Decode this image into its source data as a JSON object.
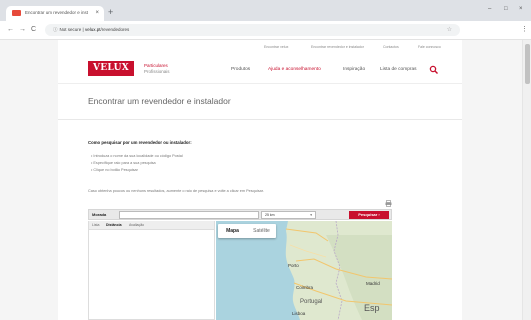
{
  "browser": {
    "tab_title": "Encontrar um revendedor e inst",
    "tab_close": "×",
    "new_tab": "+",
    "window_controls": {
      "minimize": "–",
      "maximize": "□",
      "close": "×"
    },
    "nav": {
      "back": "←",
      "forward": "→",
      "reload": "C"
    },
    "omnibox": {
      "lock": "ⓘ",
      "security": "Not secure",
      "divider": " | ",
      "host": "velux.pt",
      "path": "/revendedores"
    },
    "star": "☆",
    "menu": "⋮",
    "favicon_color": "#e64a3b"
  },
  "site": {
    "brand_color": "#c8102e",
    "logo": "VELUX",
    "utility_links": [
      "Encontrar velux",
      "Encontrar revendedor e instalador",
      "Contactos",
      "Fale connosco"
    ],
    "segments": {
      "active": "Particulares",
      "other": "Profissionais"
    },
    "nav_links": [
      "Produtos",
      "Ajuda e aconselhamento",
      "Inspiração",
      "Lista de compras"
    ],
    "page_title": "Encontrar um revendedor e instalador",
    "howto_heading": "Como pesquisar por um revendedor ou instalador:",
    "howto_bullets": [
      "• Introduza o nome da sua localidade ou código Postal",
      "• Especifique raio para a sua pesquisa",
      "• Clique no botão Pesquisar"
    ],
    "tip": "Caso obtenha poucos ou nenhuns resultados, aumente o raio de pesquisa e volte a clicar em Pesquisar."
  },
  "search": {
    "label": "Morada",
    "value": "",
    "placeholder": "",
    "radius": "25 km",
    "radius_caret": "▾",
    "button": "Pesquisar ›"
  },
  "results": {
    "tabs": [
      "Lista",
      "Distância",
      "Avaliação"
    ]
  },
  "map": {
    "tabs": {
      "map": "Mapa",
      "satellite": "Satélite"
    },
    "labels": [
      "Porto",
      "Coimbra",
      "Portugal",
      "Lisboa",
      "Madrid",
      "Esp"
    ]
  }
}
